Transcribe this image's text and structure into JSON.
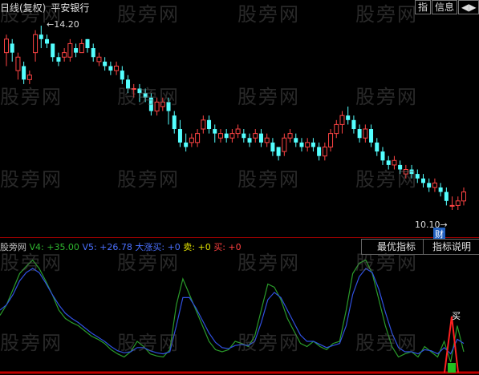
{
  "header": {
    "period_label": "日线(复权)",
    "stock_name": "平安银行",
    "buttons": [
      "指",
      "信息",
      "◀▶"
    ]
  },
  "chart_annotations": {
    "high_label": "14.20",
    "low_label": "10.10",
    "finance_badge": "财",
    "buy_signal_label": "买"
  },
  "indicator_header": {
    "name": "股旁网",
    "v4": "V4: +35.00",
    "v5": "V5: +26.78",
    "big_rise": "大涨买: +0",
    "sell": "卖: +0",
    "buy": "买: +0"
  },
  "indicator_buttons": {
    "best": "最优指标",
    "help": "指标说明"
  },
  "watermark": "股旁网",
  "colors": {
    "up": "#ff4444",
    "down": "#54ffff",
    "v4_line": "#2a9b2a",
    "v5_line": "#3050e0",
    "separator": "#a00000"
  },
  "chart_data": {
    "type": "candlestick",
    "y_range": [
      10.1,
      14.2
    ],
    "candles": [
      [
        13.6,
        13.9,
        13.3,
        14.0
      ],
      [
        13.8,
        13.6,
        13.4,
        13.9
      ],
      [
        13.2,
        13.5,
        13.0,
        13.6
      ],
      [
        13.3,
        13.0,
        12.9,
        13.4
      ],
      [
        13.0,
        13.1,
        12.9,
        13.2
      ],
      [
        13.6,
        14.0,
        13.4,
        14.1
      ],
      [
        14.0,
        13.9,
        13.7,
        14.2
      ],
      [
        13.9,
        13.8,
        13.7,
        14.0
      ],
      [
        13.8,
        13.5,
        13.4,
        13.8
      ],
      [
        13.5,
        13.4,
        13.3,
        13.6
      ],
      [
        13.5,
        13.6,
        13.4,
        13.7
      ],
      [
        13.5,
        13.8,
        13.4,
        13.9
      ],
      [
        13.7,
        13.6,
        13.5,
        13.8
      ],
      [
        13.6,
        13.8,
        13.6,
        13.9
      ],
      [
        13.9,
        13.7,
        13.6,
        13.9
      ],
      [
        13.7,
        13.5,
        13.4,
        13.8
      ],
      [
        13.4,
        13.5,
        13.3,
        13.6
      ],
      [
        13.4,
        13.3,
        13.2,
        13.5
      ],
      [
        13.3,
        13.2,
        13.1,
        13.4
      ],
      [
        13.2,
        13.3,
        13.1,
        13.4
      ],
      [
        13.2,
        13.0,
        12.9,
        13.3
      ],
      [
        13.0,
        12.8,
        12.7,
        13.1
      ],
      [
        12.8,
        12.8,
        12.6,
        12.9
      ],
      [
        12.8,
        12.7,
        12.5,
        12.9
      ],
      [
        12.7,
        12.6,
        12.5,
        12.8
      ],
      [
        12.6,
        12.3,
        12.2,
        12.7
      ],
      [
        12.3,
        12.5,
        12.2,
        12.6
      ],
      [
        12.4,
        12.5,
        12.3,
        12.6
      ],
      [
        12.5,
        12.3,
        12.0,
        12.6
      ],
      [
        12.2,
        11.9,
        11.8,
        12.3
      ],
      [
        11.9,
        11.6,
        11.5,
        12.1
      ],
      [
        11.6,
        11.5,
        11.4,
        11.8
      ],
      [
        11.6,
        11.7,
        11.5,
        11.8
      ],
      [
        11.6,
        11.8,
        11.5,
        11.9
      ],
      [
        11.9,
        12.1,
        11.8,
        12.2
      ],
      [
        12.1,
        11.9,
        11.8,
        12.2
      ],
      [
        11.9,
        11.8,
        11.6,
        12.0
      ],
      [
        11.7,
        11.8,
        11.6,
        11.9
      ],
      [
        11.8,
        11.7,
        11.6,
        11.9
      ],
      [
        11.7,
        11.8,
        11.6,
        11.9
      ],
      [
        11.8,
        11.9,
        11.7,
        12.0
      ],
      [
        11.8,
        11.7,
        11.6,
        11.9
      ],
      [
        11.7,
        11.6,
        11.5,
        11.8
      ],
      [
        11.7,
        11.8,
        11.6,
        11.9
      ],
      [
        11.8,
        11.6,
        11.5,
        11.9
      ],
      [
        11.6,
        11.7,
        11.5,
        11.8
      ],
      [
        11.6,
        11.4,
        11.3,
        11.7
      ],
      [
        11.5,
        11.3,
        11.2,
        11.5
      ],
      [
        11.4,
        11.7,
        11.3,
        11.8
      ],
      [
        11.7,
        11.8,
        11.6,
        11.9
      ],
      [
        11.7,
        11.6,
        11.5,
        11.8
      ],
      [
        11.6,
        11.5,
        11.4,
        11.7
      ],
      [
        11.5,
        11.6,
        11.4,
        11.7
      ],
      [
        11.6,
        11.5,
        11.4,
        11.7
      ],
      [
        11.5,
        11.3,
        11.2,
        11.6
      ],
      [
        11.3,
        11.5,
        11.2,
        11.6
      ],
      [
        11.5,
        11.8,
        11.4,
        11.9
      ],
      [
        11.8,
        12.0,
        11.7,
        12.1
      ],
      [
        12.0,
        12.2,
        11.8,
        12.3
      ],
      [
        12.2,
        12.1,
        12.0,
        12.4
      ],
      [
        12.1,
        11.9,
        11.8,
        12.2
      ],
      [
        11.9,
        11.7,
        11.6,
        12.0
      ],
      [
        11.7,
        11.9,
        11.6,
        12.0
      ],
      [
        11.9,
        11.6,
        11.5,
        12.0
      ],
      [
        11.6,
        11.4,
        11.3,
        11.7
      ],
      [
        11.4,
        11.2,
        11.1,
        11.5
      ],
      [
        11.2,
        11.1,
        11.0,
        11.3
      ],
      [
        11.1,
        11.2,
        11.0,
        11.3
      ],
      [
        11.1,
        11.0,
        10.9,
        11.2
      ],
      [
        10.9,
        11.0,
        10.8,
        11.1
      ],
      [
        11.0,
        10.9,
        10.8,
        11.1
      ],
      [
        10.9,
        10.8,
        10.7,
        11.0
      ],
      [
        10.8,
        10.7,
        10.6,
        10.9
      ],
      [
        10.7,
        10.6,
        10.5,
        10.8
      ],
      [
        10.6,
        10.7,
        10.5,
        10.8
      ],
      [
        10.6,
        10.5,
        10.4,
        10.7
      ],
      [
        10.5,
        10.3,
        10.2,
        10.6
      ],
      [
        10.2,
        10.2,
        10.1,
        10.4
      ],
      [
        10.2,
        10.3,
        10.1,
        10.4
      ],
      [
        10.3,
        10.5,
        10.2,
        10.6
      ]
    ],
    "v4": [
      0.45,
      0.55,
      0.7,
      0.85,
      0.92,
      0.98,
      0.9,
      0.78,
      0.65,
      0.5,
      0.42,
      0.38,
      0.35,
      0.3,
      0.25,
      0.22,
      0.18,
      0.12,
      0.08,
      0.05,
      0.1,
      0.2,
      0.15,
      0.08,
      0.06,
      0.05,
      0.12,
      0.55,
      0.8,
      0.65,
      0.5,
      0.35,
      0.2,
      0.12,
      0.1,
      0.12,
      0.2,
      0.18,
      0.15,
      0.25,
      0.5,
      0.75,
      0.72,
      0.6,
      0.42,
      0.3,
      0.18,
      0.15,
      0.2,
      0.15,
      0.12,
      0.18,
      0.2,
      0.5,
      0.85,
      0.95,
      0.98,
      0.85,
      0.6,
      0.35,
      0.15,
      0.05,
      0.08,
      0.1,
      0.05,
      0.15,
      0.1,
      0.05,
      0.2,
      0.0,
      0.35,
      0.1
    ],
    "v5": [
      0.5,
      0.55,
      0.65,
      0.78,
      0.86,
      0.9,
      0.86,
      0.76,
      0.65,
      0.55,
      0.47,
      0.42,
      0.38,
      0.33,
      0.28,
      0.24,
      0.2,
      0.15,
      0.11,
      0.09,
      0.1,
      0.14,
      0.14,
      0.11,
      0.09,
      0.08,
      0.1,
      0.35,
      0.62,
      0.62,
      0.52,
      0.4,
      0.28,
      0.19,
      0.14,
      0.13,
      0.16,
      0.17,
      0.16,
      0.2,
      0.38,
      0.6,
      0.67,
      0.62,
      0.5,
      0.38,
      0.26,
      0.2,
      0.2,
      0.17,
      0.14,
      0.16,
      0.18,
      0.35,
      0.65,
      0.82,
      0.9,
      0.86,
      0.7,
      0.48,
      0.28,
      0.14,
      0.1,
      0.1,
      0.08,
      0.12,
      0.11,
      0.08,
      0.14,
      0.08,
      0.22,
      0.18
    ]
  }
}
